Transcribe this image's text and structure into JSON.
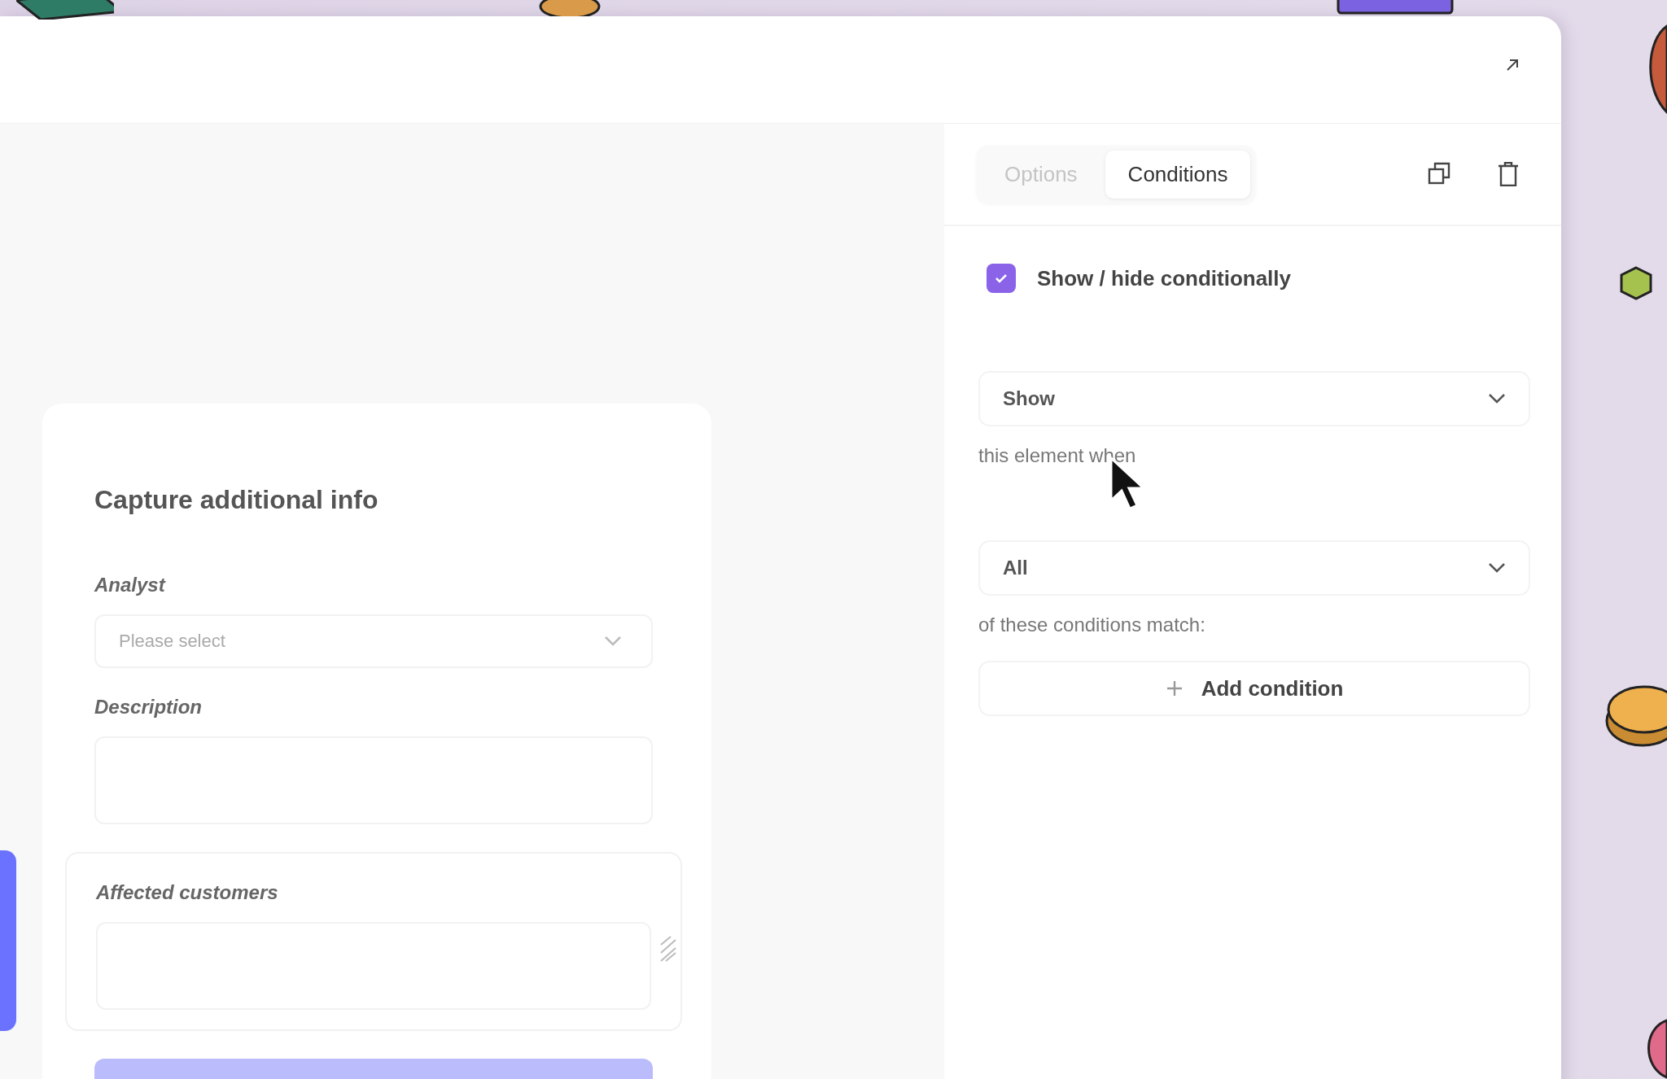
{
  "form": {
    "title": "Capture additional info",
    "fields": [
      {
        "label": "Analyst",
        "kind": "select",
        "placeholder": "Please select",
        "selected": false
      },
      {
        "label": "Description",
        "kind": "textarea",
        "selected": false
      },
      {
        "label": "Affected customers",
        "kind": "textarea",
        "selected": true
      }
    ]
  },
  "panel": {
    "tabs": [
      {
        "label": "Options",
        "selected": false
      },
      {
        "label": "Conditions",
        "selected": true
      }
    ],
    "toggle": {
      "label": "Show / hide conditionally",
      "checked": true
    },
    "visibility_select": {
      "value": "Show"
    },
    "visibility_text": "this element when",
    "match_select": {
      "value": "All"
    },
    "match_text": "of these conditions match:",
    "add_button": {
      "label": "Add condition"
    }
  }
}
